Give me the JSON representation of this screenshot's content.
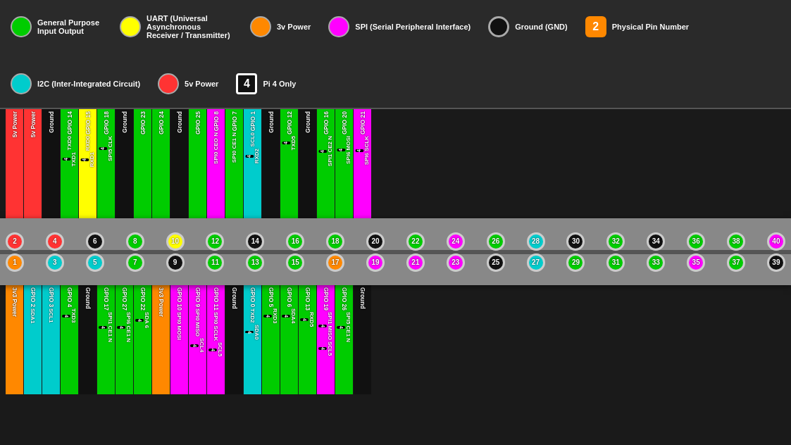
{
  "legend": {
    "items": [
      {
        "id": "gpio",
        "color": "#00cc00",
        "label": "General Purpose\nInput Output",
        "type": "circle"
      },
      {
        "id": "uart",
        "color": "#ffff00",
        "label": "UART (Universal Asynchronous\nReceiver / Transmitter)",
        "type": "circle"
      },
      {
        "id": "3v",
        "color": "#ff8800",
        "label": "3v Power",
        "type": "circle"
      },
      {
        "id": "spi",
        "color": "#ff00ff",
        "label": "SPI (Serial Peripheral Interface)",
        "type": "circle"
      },
      {
        "id": "gnd",
        "color": "#111111",
        "label": "Ground (GND)",
        "type": "circle"
      },
      {
        "id": "pin-badge",
        "color": "#ff8800",
        "label": "Physical Pin Number",
        "type": "badge",
        "value": "2"
      },
      {
        "id": "i2c",
        "color": "#00cccc",
        "label": "I2C (Inter-Integrated Circuit)",
        "type": "circle"
      },
      {
        "id": "5v",
        "color": "#ff3333",
        "label": "5v Power",
        "type": "circle"
      },
      {
        "id": "pi4",
        "color": "#111111",
        "label": "Pi 4 Only",
        "type": "badge-dark",
        "value": "4"
      }
    ]
  },
  "pins_top": [
    {
      "num": 2,
      "color": "#ff3333",
      "label": "5v Power",
      "secondary": []
    },
    {
      "num": 4,
      "color": "#ff3333",
      "label": "5v Power",
      "secondary": []
    },
    {
      "num": 6,
      "color": "#111",
      "label": "Ground",
      "secondary": []
    },
    {
      "num": 8,
      "color": "#00cc00",
      "label": "GPIO 14",
      "secondary": [
        "TXD0",
        "4 TXD1"
      ]
    },
    {
      "num": 10,
      "color": "#ffff00",
      "label": "GPIO 15",
      "secondary": [
        "RXD0",
        "4 RXD1"
      ]
    },
    {
      "num": 12,
      "color": "#00cc00",
      "label": "GPIO 18",
      "secondary": [
        "4 SPI5 CLK"
      ]
    },
    {
      "num": 14,
      "color": "#111",
      "label": "Ground",
      "secondary": []
    },
    {
      "num": 16,
      "color": "#00cc00",
      "label": "GPIO 23",
      "secondary": []
    },
    {
      "num": 18,
      "color": "#00cc00",
      "label": "GPIO 24",
      "secondary": []
    },
    {
      "num": 20,
      "color": "#111",
      "label": "Ground",
      "secondary": []
    },
    {
      "num": 22,
      "color": "#00cc00",
      "label": "GPIO 25",
      "secondary": []
    },
    {
      "num": 24,
      "color": "#ff00ff",
      "label": "GPIO 8",
      "secondary": [
        "SPI0 CEO N"
      ]
    },
    {
      "num": 26,
      "color": "#00cc00",
      "label": "GPIO 7",
      "secondary": [
        "SPI0 CE1 N"
      ]
    },
    {
      "num": 28,
      "color": "#00cccc",
      "label": "GPIO 1",
      "secondary": [
        "SCL0",
        "4 RXD2"
      ]
    },
    {
      "num": 30,
      "color": "#111",
      "label": "Ground",
      "secondary": []
    },
    {
      "num": 32,
      "color": "#00cc00",
      "label": "GPIO 12",
      "secondary": [
        "4 TXD5"
      ]
    },
    {
      "num": 34,
      "color": "#111",
      "label": "Ground",
      "secondary": []
    },
    {
      "num": 36,
      "color": "#00cc00",
      "label": "GPIO 16",
      "secondary": [
        "4 SPI1 CE2 N"
      ]
    },
    {
      "num": 38,
      "color": "#00cc00",
      "label": "GPIO 20",
      "secondary": [
        "4 SPI6 MOSI"
      ]
    },
    {
      "num": 40,
      "color": "#ff00ff",
      "label": "GPIO 21",
      "secondary": [
        "4 SPI6 SCLK"
      ]
    }
  ],
  "pins_bottom": [
    {
      "num": 1,
      "color": "#ff8800",
      "label": "3v3 Power",
      "secondary": []
    },
    {
      "num": 3,
      "color": "#00cccc",
      "label": "GPIO 2",
      "secondary": [
        "SDA1"
      ]
    },
    {
      "num": 5,
      "color": "#00cccc",
      "label": "GPIO 3",
      "secondary": [
        "SCL1"
      ]
    },
    {
      "num": 7,
      "color": "#00cc00",
      "label": "GPIO 4",
      "secondary": [
        "4 TXD3"
      ]
    },
    {
      "num": 9,
      "color": "#111",
      "label": "Ground",
      "secondary": []
    },
    {
      "num": 11,
      "color": "#00cc00",
      "label": "GPIO 17",
      "secondary": [
        "4 SPI1 CE1 N"
      ]
    },
    {
      "num": 13,
      "color": "#00cc00",
      "label": "GPIO 27",
      "secondary": [
        "4 SPI6 CE1 N"
      ]
    },
    {
      "num": 15,
      "color": "#00cc00",
      "label": "GPIO 22",
      "secondary": [
        "4 SDA 6"
      ]
    },
    {
      "num": 17,
      "color": "#ff8800",
      "label": "3v3 Power",
      "secondary": []
    },
    {
      "num": 19,
      "color": "#ff00ff",
      "label": "GPIO 10",
      "secondary": [
        "SPI0 MOSI"
      ]
    },
    {
      "num": 21,
      "color": "#ff00ff",
      "label": "GPIO 9",
      "secondary": [
        "SPI0 MISO",
        "4 SCL4"
      ]
    },
    {
      "num": 23,
      "color": "#ff00ff",
      "label": "GPIO 11",
      "secondary": [
        "SPI0 SCLK",
        "4 SCL5"
      ]
    },
    {
      "num": 25,
      "color": "#111",
      "label": "Ground",
      "secondary": []
    },
    {
      "num": 27,
      "color": "#00cccc",
      "label": "GPIO 0",
      "secondary": [
        "TXD2",
        "4 SDA0"
      ]
    },
    {
      "num": 29,
      "color": "#00cc00",
      "label": "GPIO 5",
      "secondary": [
        "4 RXD3"
      ]
    },
    {
      "num": 31,
      "color": "#00cc00",
      "label": "GPIO 6",
      "secondary": [
        "4 SDA4"
      ]
    },
    {
      "num": 33,
      "color": "#00cc00",
      "label": "GPIO 13",
      "secondary": [
        "4 RXD5"
      ]
    },
    {
      "num": 35,
      "color": "#ff00ff",
      "label": "GPIO 19",
      "secondary": [
        "4 SPI1 MISO",
        "4 SCL5"
      ]
    },
    {
      "num": 37,
      "color": "#00cc00",
      "label": "GPIO 26",
      "secondary": [
        "4 SPI5 CE1 N"
      ]
    },
    {
      "num": 39,
      "color": "#111",
      "label": "Ground",
      "secondary": []
    }
  ]
}
